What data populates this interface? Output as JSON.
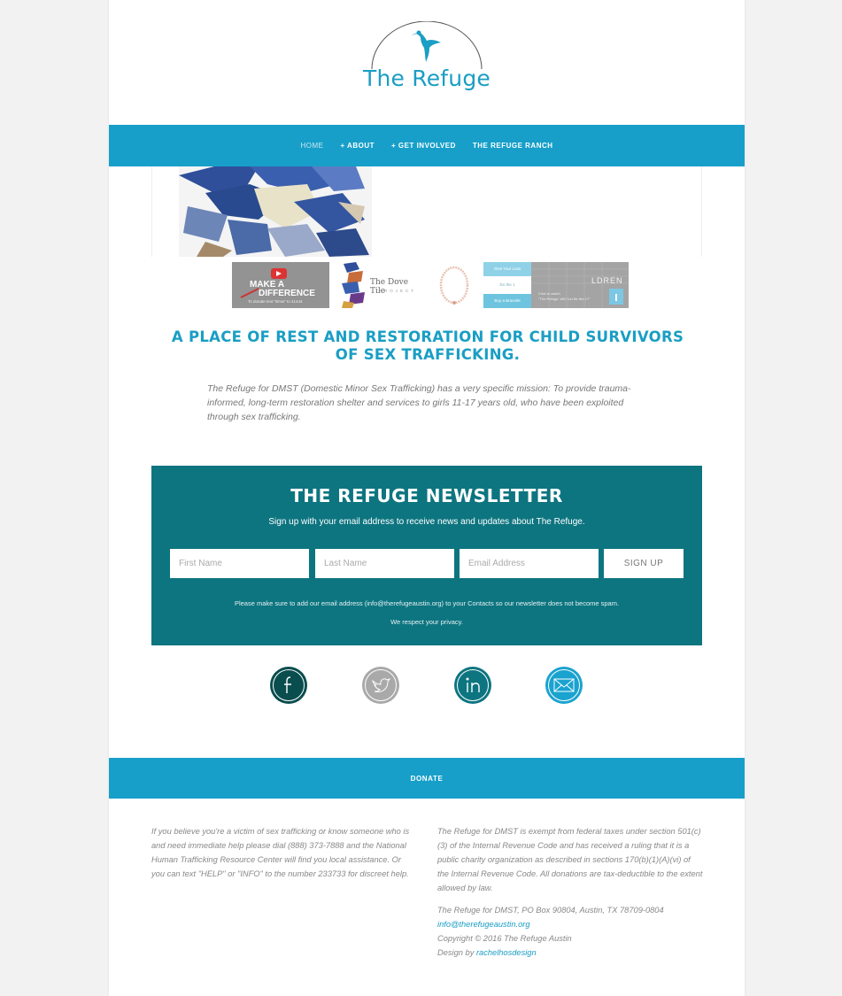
{
  "site": {
    "logo_text": "The Refuge",
    "brand_color": "#179fc9",
    "dark_teal": "#0d7580"
  },
  "nav": {
    "items": [
      {
        "label": "HOME"
      },
      {
        "label": "+ ABOUT"
      },
      {
        "label": "+ GET INVOLVED"
      },
      {
        "label": "THE REFUGE RANCH"
      }
    ]
  },
  "thumbnails": {
    "make_difference_line1": "MAKE A",
    "make_difference_line2": "DIFFERENCE",
    "make_difference_caption": "To donate text \"Bmw\" to 41444",
    "dove_tile_title": "The Dove Tile",
    "dove_tile_sub": "PROJECT",
    "mission_btn1": "Give Your Loss",
    "mission_btn2": "Do the 1",
    "mission_btn3": "Buy a Bracelet",
    "children_text": "LDREN",
    "children_caption1": "Click to watch",
    "children_caption2": "\"The Refuge: Will You Be the 1?\""
  },
  "headline": "A PLACE OF REST AND RESTORATION FOR CHILD SURVIVORS OF SEX TRAFFICKING.",
  "mission": "The Refuge for DMST (Domestic Minor Sex Trafficking) has a very specific mission: To provide trauma-informed, long-term restoration shelter and services to girls 11-17 years old, who have been exploited through sex trafficking.",
  "newsletter": {
    "title": "THE REFUGE NEWSLETTER",
    "subtitle": "Sign up with your email address to receive news and updates about The Refuge.",
    "first_name_placeholder": "First Name",
    "last_name_placeholder": "Last Name",
    "email_placeholder": "Email Address",
    "button": "SIGN UP",
    "note": "Please make sure to add our email address (info@therefugeaustin.org) to your Contacts so our newsletter does not become spam.",
    "privacy": "We respect your privacy."
  },
  "social": [
    {
      "icon": "facebook-icon",
      "color": "#0a4d4e"
    },
    {
      "icon": "twitter-icon",
      "color": "#a9a9a9"
    },
    {
      "icon": "linkedin-icon",
      "color": "#0d7580"
    },
    {
      "icon": "email-icon",
      "color": "#1aa3cf"
    }
  ],
  "donate": {
    "label": "DONATE"
  },
  "footer": {
    "left": "If you believe you're a victim of sex trafficking or know someone who is and need immediate help please dial (888) 373-7888 and the National Human Trafficking Resource Center will find you local assistance. Or you can text \"HELP\" or \"INFO\" to the number 233733 for discreet help.",
    "tax": "The Refuge for DMST is exempt from federal taxes under section 501(c)(3) of the Internal Revenue Code and has received a ruling that it is a public charity organization as described in sections 170(b)(1)(A)(vi) of the Internal Revenue Code. All donations are tax-deductible to the extent allowed by law.",
    "address": "The Refuge for DMST, PO Box 90804, Austin, TX 78709-0804",
    "email": "info@therefugeaustin.org",
    "copyright": "Copyright © 2016 The Refuge Austin",
    "design_prefix": "Design by ",
    "design_link": "rachelhosdesign"
  }
}
